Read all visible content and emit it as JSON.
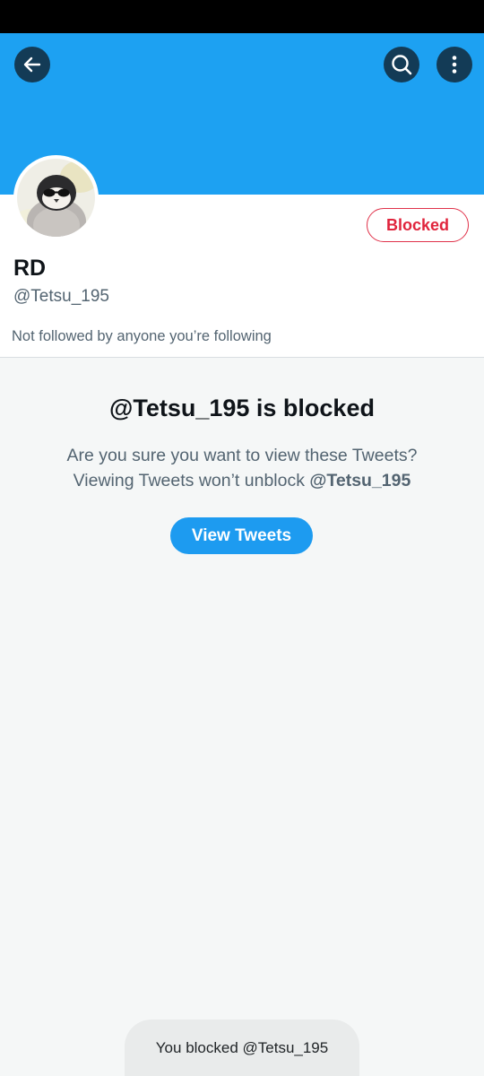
{
  "profile": {
    "display_name": "RD",
    "handle": "@Tetsu_195",
    "relationship_button_label": "Blocked",
    "followed_by_note": "Not followed by anyone you’re following"
  },
  "blocked_notice": {
    "title": "@Tetsu_195 is blocked",
    "description_line1": "Are you sure you want to view these Tweets?",
    "description_line2_prefix": "Viewing Tweets won’t unblock ",
    "description_line2_handle": "@Tetsu_195",
    "view_button_label": "View Tweets"
  },
  "toast": {
    "message": "You blocked @Tetsu_195"
  },
  "icons": {
    "back": "arrow-left-icon",
    "search": "search-icon",
    "more": "more-vertical-icon"
  },
  "colors": {
    "banner": "#1da1f2",
    "primary_button": "#1d9bf0",
    "blocked_red": "#e0243c"
  }
}
